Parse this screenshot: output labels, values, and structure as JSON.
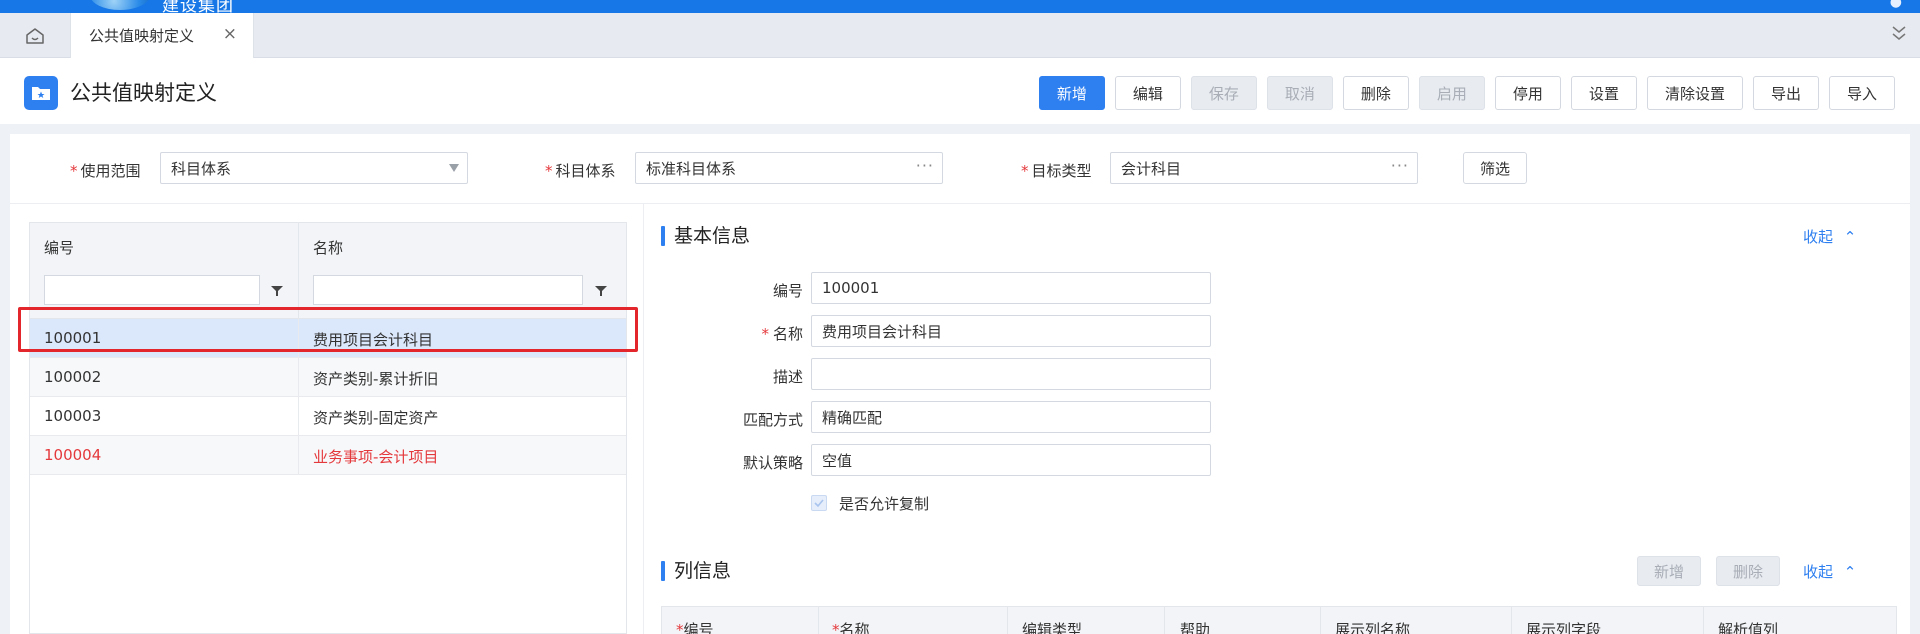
{
  "brand": {
    "name": "建设集团"
  },
  "tabs": [
    {
      "label": "公共值映射定义"
    }
  ],
  "page": {
    "title": "公共值映射定义"
  },
  "toolbar": {
    "buttons": [
      "新增",
      "编辑",
      "保存",
      "取消",
      "删除",
      "启用",
      "停用",
      "设置",
      "清除设置",
      "导出",
      "导入"
    ]
  },
  "filters": {
    "scope_label": "使用范围",
    "scope_value": "科目体系",
    "system_label": "科目体系",
    "system_value": "标准科目体系",
    "target_label": "目标类型",
    "target_value": "会计科目",
    "search_button": "筛选"
  },
  "grid": {
    "columns": [
      "编号",
      "名称"
    ],
    "rows": [
      {
        "code": "100001",
        "name": "费用项目会计科目"
      },
      {
        "code": "100002",
        "name": "资产类别-累计折旧"
      },
      {
        "code": "100003",
        "name": "资产类别-固定资产"
      },
      {
        "code": "100004",
        "name": "业务事项-会计项目"
      }
    ]
  },
  "basic_info": {
    "title": "基本信息",
    "collapse": "收起",
    "fields": [
      {
        "label": "编号",
        "value": "100001"
      },
      {
        "label": "名称",
        "value": "费用项目会计科目"
      },
      {
        "label": "描述",
        "value": ""
      },
      {
        "label": "匹配方式",
        "value": "精确匹配"
      },
      {
        "label": "默认策略",
        "value": "空值"
      }
    ],
    "allow_copy_label": "是否允许复制"
  },
  "column_info": {
    "title": "列信息",
    "add_button": "新增",
    "delete_button": "删除",
    "collapse": "收起",
    "headers": [
      "编号",
      "名称",
      "编辑类型",
      "帮助",
      "展示列名称",
      "展示列字段",
      "解析值列"
    ]
  },
  "colors": {
    "accent": "#2e7ff0",
    "brand_bar": "#1777e6",
    "required": "#e4393c",
    "selected_row": "#dbe7fb"
  }
}
